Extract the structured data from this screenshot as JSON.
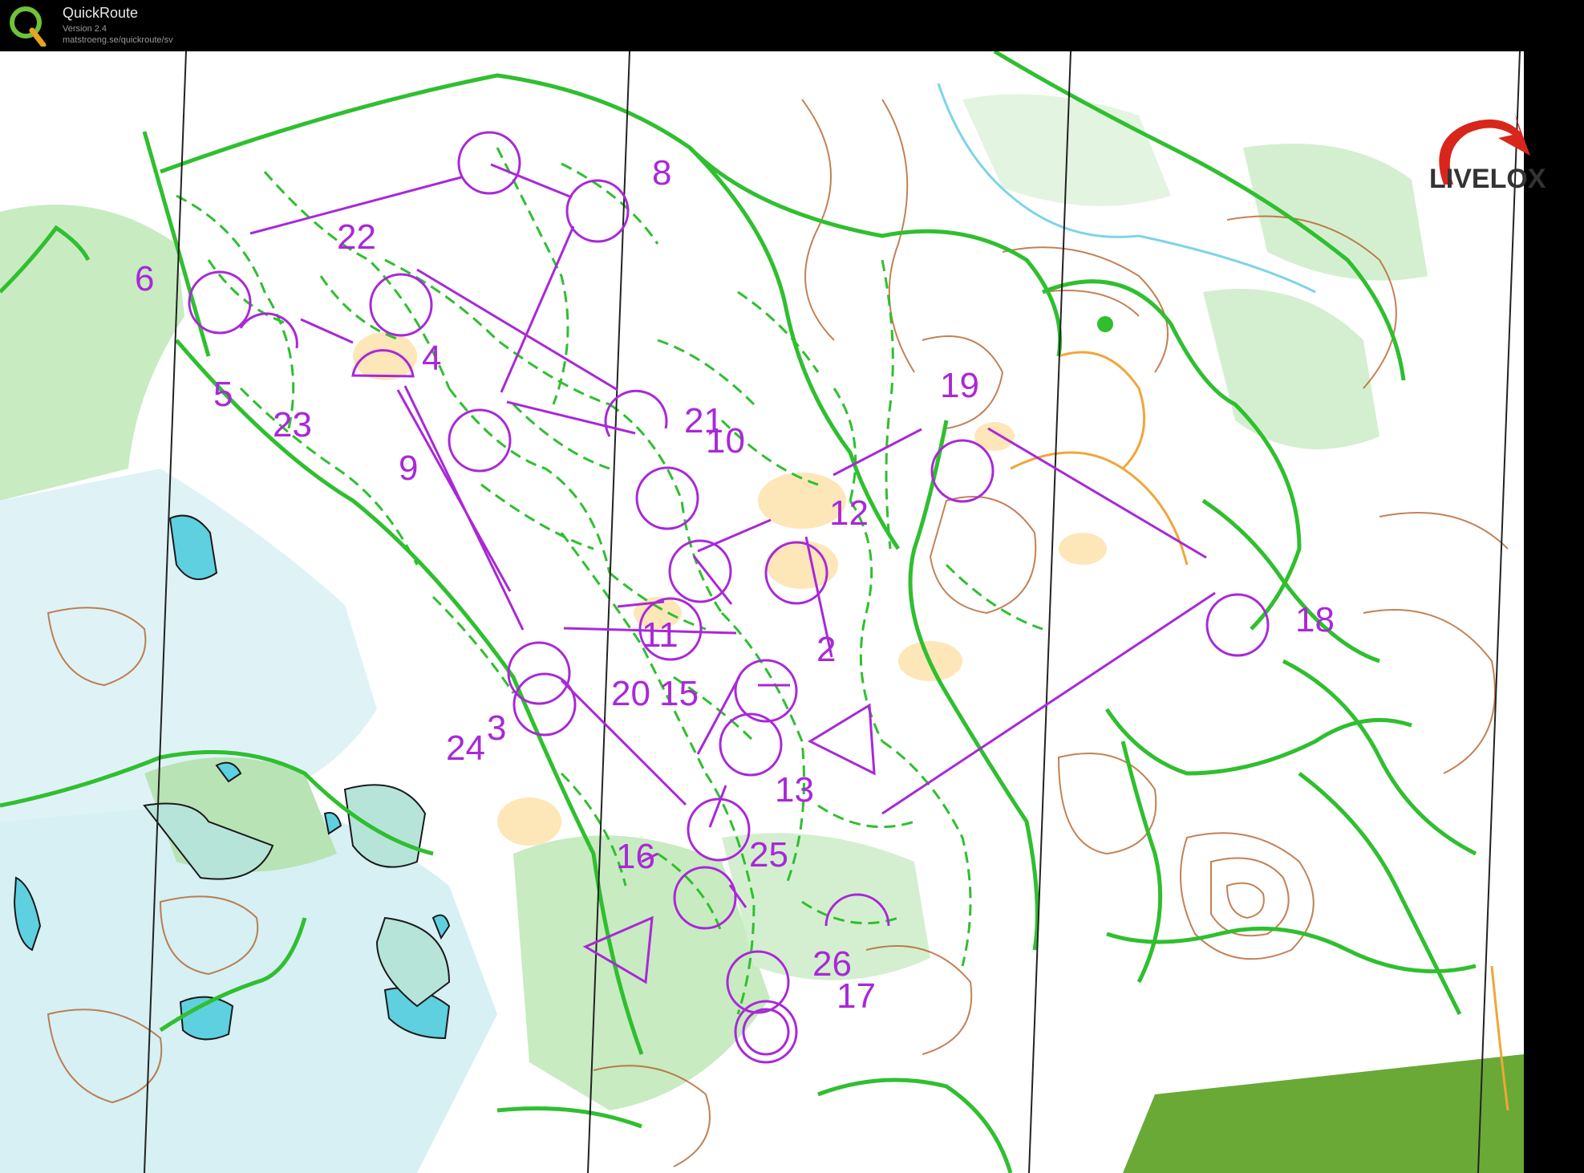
{
  "app": {
    "title": "QuickRoute",
    "version": "Version 2.4",
    "url": "matstroeng.se/quickroute/sv"
  },
  "brand": {
    "name": "LIVELOX",
    "accent": "#d8261c",
    "text_color": "#333333"
  },
  "map": {
    "colors": {
      "background": "#ffffff",
      "vegetation_light": "#c8ebc1",
      "vegetation_mid": "#a7dca0",
      "open_yellow": "#fde6b8",
      "marsh_blue": "#9fdde8",
      "water": "#5fd0e0",
      "contour_brown": "#b0581e",
      "path_green": "#2fbf2f",
      "course_purple": "#a928d8",
      "north_lines": "#222222"
    },
    "control_labels": [
      "22",
      "8",
      "6",
      "4",
      "5",
      "23",
      "19",
      "21",
      "10",
      "9",
      "12",
      "18",
      "2",
      "11",
      "20",
      "15",
      "24",
      "3",
      "13",
      "16",
      "25",
      "26",
      "17"
    ]
  }
}
